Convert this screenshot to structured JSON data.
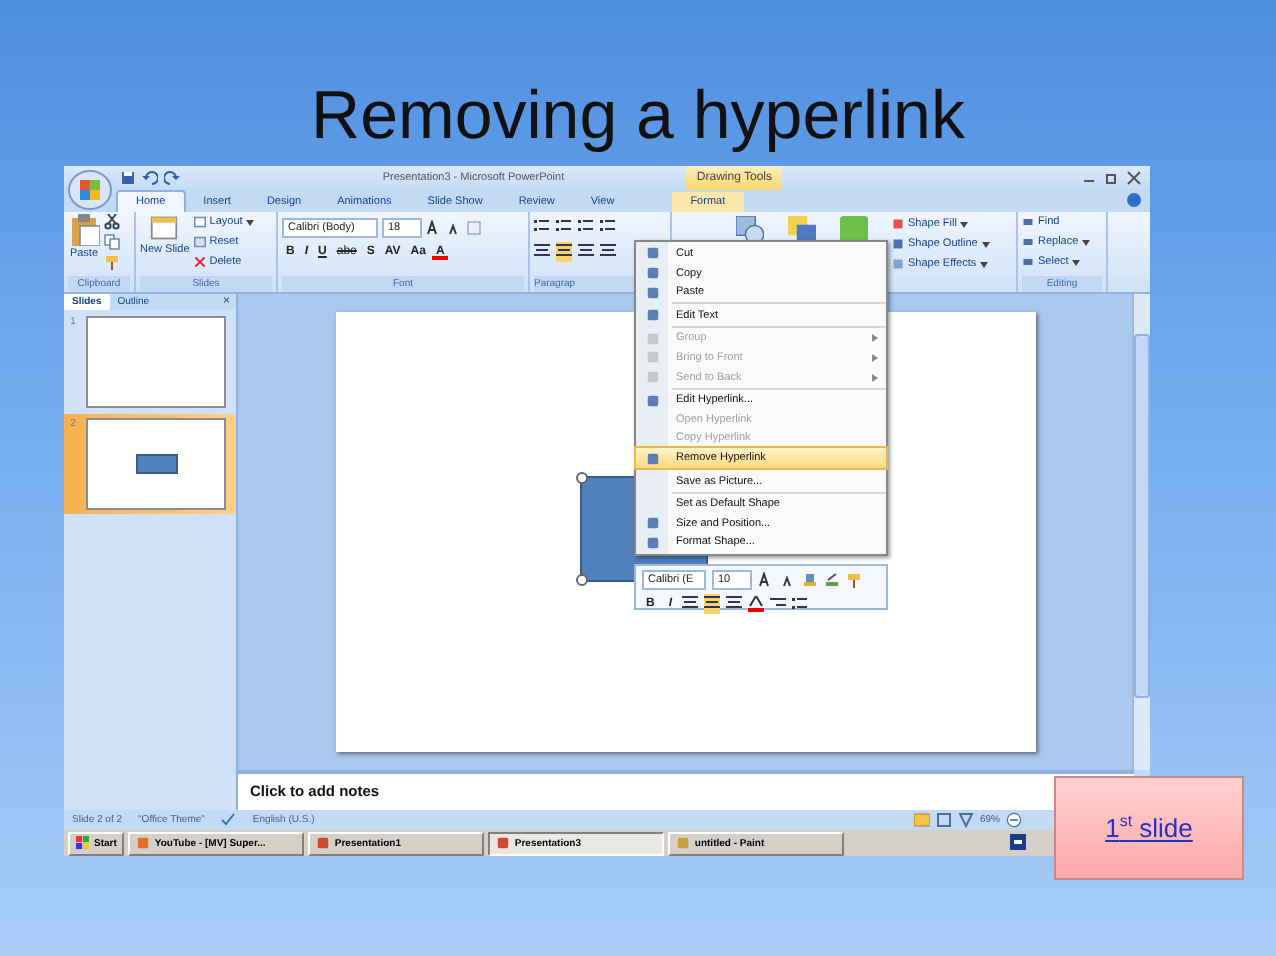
{
  "slide_title": "Removing a hyperlink",
  "window": {
    "title": "Presentation3 - Microsoft PowerPoint",
    "contextual_group": "Drawing Tools"
  },
  "tabs": [
    {
      "label": "Home",
      "selected": true,
      "contextual": false
    },
    {
      "label": "Insert",
      "selected": false,
      "contextual": false
    },
    {
      "label": "Design",
      "selected": false,
      "contextual": false
    },
    {
      "label": "Animations",
      "selected": false,
      "contextual": false
    },
    {
      "label": "Slide Show",
      "selected": false,
      "contextual": false
    },
    {
      "label": "Review",
      "selected": false,
      "contextual": false
    },
    {
      "label": "View",
      "selected": false,
      "contextual": false
    },
    {
      "label": "Format",
      "selected": false,
      "contextual": true
    }
  ],
  "ribbon": {
    "clipboard": {
      "paste": "Paste",
      "label": "Clipboard"
    },
    "slides": {
      "new_slide": "New Slide",
      "layout": "Layout",
      "reset": "Reset",
      "delete": "Delete",
      "label": "Slides"
    },
    "font": {
      "family": "Calibri (Body)",
      "size": "18",
      "buttons": [
        "B",
        "I",
        "U",
        "abe",
        "S",
        "AV",
        "Aa",
        "A"
      ],
      "label": "Font"
    },
    "paragraph": {
      "label": "Paragrap"
    },
    "drawing": {
      "items": [
        "Shape Fill",
        "Shape Outline",
        "Shape Effects"
      ]
    },
    "editing": {
      "items": [
        "Find",
        "Replace",
        "Select"
      ],
      "label": "Editing"
    }
  },
  "pane": {
    "tabs": [
      {
        "label": "Slides",
        "selected": true
      },
      {
        "label": "Outline",
        "selected": false
      }
    ],
    "close": "×",
    "slides": [
      {
        "number": "1",
        "selected": false,
        "has_shape": false
      },
      {
        "number": "2",
        "selected": true,
        "has_shape": true
      }
    ]
  },
  "context_menu": {
    "items": [
      {
        "kind": "item",
        "label": "Cut",
        "icon": true,
        "disabled": false,
        "submenu": false,
        "selected": false
      },
      {
        "kind": "item",
        "label": "Copy",
        "icon": true,
        "disabled": false,
        "submenu": false,
        "selected": false
      },
      {
        "kind": "item",
        "label": "Paste",
        "icon": true,
        "disabled": false,
        "submenu": false,
        "selected": false
      },
      {
        "kind": "separator"
      },
      {
        "kind": "item",
        "label": "Edit Text",
        "icon": true,
        "disabled": false,
        "submenu": false,
        "selected": false
      },
      {
        "kind": "separator"
      },
      {
        "kind": "item",
        "label": "Group",
        "icon": true,
        "disabled": true,
        "submenu": true,
        "selected": false
      },
      {
        "kind": "item",
        "label": "Bring to Front",
        "icon": true,
        "disabled": true,
        "submenu": true,
        "selected": false
      },
      {
        "kind": "item",
        "label": "Send to Back",
        "icon": true,
        "disabled": true,
        "submenu": true,
        "selected": false
      },
      {
        "kind": "separator"
      },
      {
        "kind": "item",
        "label": "Edit Hyperlink...",
        "icon": true,
        "disabled": false,
        "submenu": false,
        "selected": false
      },
      {
        "kind": "item",
        "label": "Open Hyperlink",
        "icon": false,
        "disabled": true,
        "submenu": false,
        "selected": false
      },
      {
        "kind": "item",
        "label": "Copy Hyperlink",
        "icon": false,
        "disabled": true,
        "submenu": false,
        "selected": false
      },
      {
        "kind": "item",
        "label": "Remove Hyperlink",
        "icon": true,
        "disabled": false,
        "submenu": false,
        "selected": true
      },
      {
        "kind": "separator"
      },
      {
        "kind": "item",
        "label": "Save as Picture...",
        "icon": false,
        "disabled": false,
        "submenu": false,
        "selected": false
      },
      {
        "kind": "separator"
      },
      {
        "kind": "item",
        "label": "Set as Default Shape",
        "icon": false,
        "disabled": false,
        "submenu": false,
        "selected": false
      },
      {
        "kind": "item",
        "label": "Size and Position...",
        "icon": true,
        "disabled": false,
        "submenu": false,
        "selected": false
      },
      {
        "kind": "item",
        "label": "Format Shape...",
        "icon": true,
        "disabled": false,
        "submenu": false,
        "selected": false
      }
    ]
  },
  "mini_toolbar": {
    "font": "Calibri (E",
    "size": "10",
    "buttons": [
      "B",
      "I"
    ]
  },
  "notes": {
    "placeholder": "Click to add notes"
  },
  "status_bar": {
    "slide": "Slide 2 of 2",
    "theme": "\"Office Theme\"",
    "language": "English (U.S.)",
    "zoom": "69%"
  },
  "taskbar": {
    "start": "Start",
    "buttons": [
      {
        "label": "YouTube - [MV] Super...",
        "selected": false
      },
      {
        "label": "Presentation1",
        "selected": false
      },
      {
        "label": "Presentation3",
        "selected": true
      },
      {
        "label": "untitled - Paint",
        "selected": false
      }
    ]
  },
  "link_button": "1$^{st}$ slide"
}
